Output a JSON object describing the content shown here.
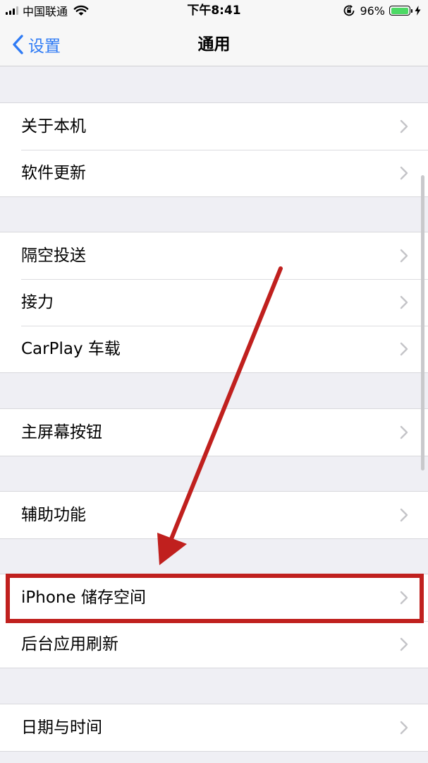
{
  "status_bar": {
    "carrier": "中国联通",
    "time": "下午8:41",
    "battery_percent_text": "96%",
    "battery_level": 0.96,
    "battery_color": "#4cd964"
  },
  "nav": {
    "back_label": "设置",
    "title": "通用",
    "accent_color": "#2f7bf5"
  },
  "groups": [
    {
      "items": [
        {
          "label": "关于本机"
        },
        {
          "label": "软件更新"
        }
      ]
    },
    {
      "items": [
        {
          "label": "隔空投送"
        },
        {
          "label": "接力"
        },
        {
          "label": "CarPlay 车载"
        }
      ]
    },
    {
      "items": [
        {
          "label": "主屏幕按钮"
        }
      ]
    },
    {
      "items": [
        {
          "label": "辅助功能"
        }
      ]
    },
    {
      "items": [
        {
          "label": "iPhone 储存空间"
        },
        {
          "label": "后台应用刷新"
        }
      ]
    },
    {
      "items": [
        {
          "label": "日期与时间"
        }
      ]
    }
  ],
  "icons": {
    "back": "chevron-left-icon",
    "disclosure": "chevron-right-icon",
    "wifi": "wifi-icon",
    "rotation_lock": "rotation-lock-icon",
    "charging": "charging-bolt-icon"
  },
  "annotation": {
    "color": "#c0201e",
    "highlighted_item": "iPhone 储存空间"
  }
}
